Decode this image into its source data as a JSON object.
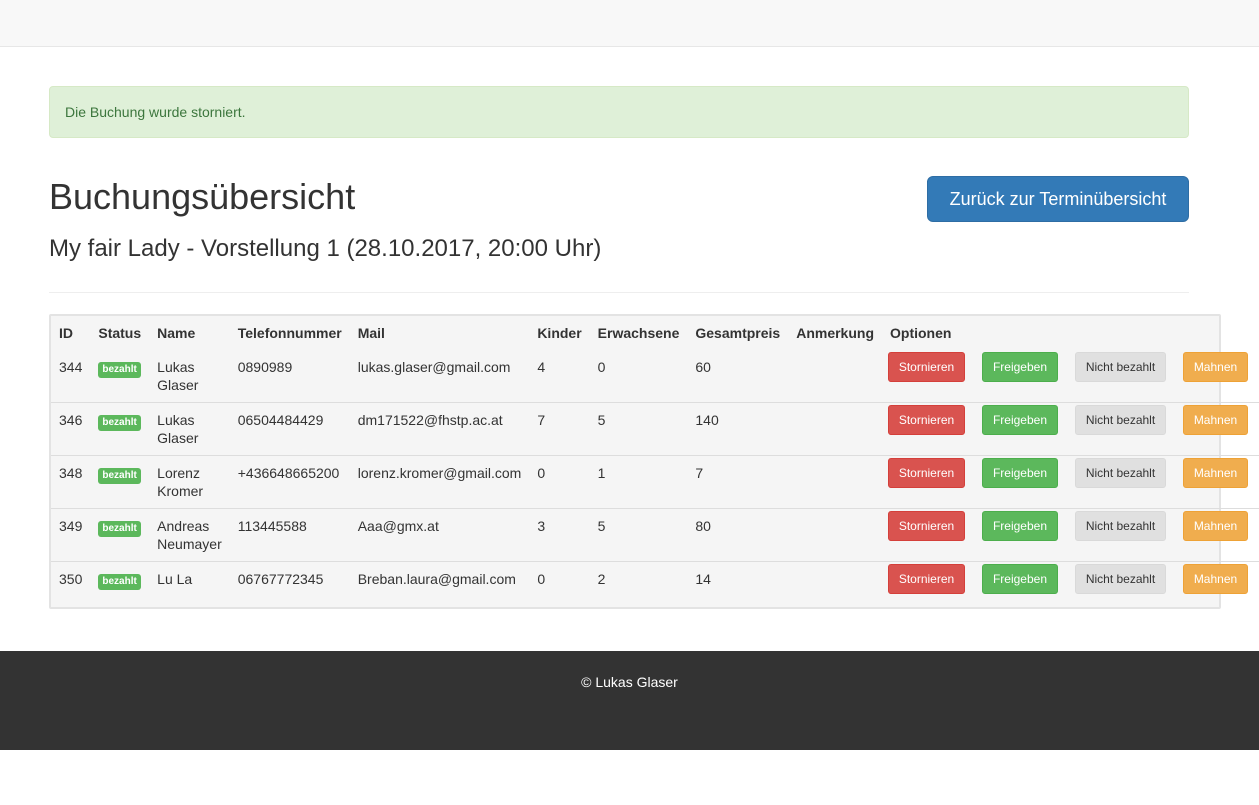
{
  "alert": {
    "text": "Die Buchung wurde storniert."
  },
  "header": {
    "title": "Buchungsübersicht",
    "back_button": "Zurück zur Terminübersicht",
    "subtitle": "My fair Lady - Vorstellung 1 (28.10.2017, 20:00 Uhr)"
  },
  "table": {
    "columns": [
      "ID",
      "Status",
      "Name",
      "Telefonnummer",
      "Mail",
      "Kinder",
      "Erwachsene",
      "Gesamtpreis",
      "Anmerkung",
      "Optionen"
    ],
    "actions": {
      "cancel": "Stornieren",
      "release": "Freigeben",
      "unpaid": "Nicht bezahlt",
      "remind": "Mahnen"
    },
    "rows": [
      {
        "id": "344",
        "status": "bezahlt",
        "name": "Lukas Glaser",
        "phone": "0890989",
        "mail": "lukas.glaser@gmail.com",
        "children": "4",
        "adults": "0",
        "total": "60",
        "note": ""
      },
      {
        "id": "346",
        "status": "bezahlt",
        "name": "Lukas Glaser",
        "phone": "06504484429",
        "mail": "dm171522@fhstp.ac.at",
        "children": "7",
        "adults": "5",
        "total": "140",
        "note": ""
      },
      {
        "id": "348",
        "status": "bezahlt",
        "name": "Lorenz Kromer",
        "phone": "+436648665200",
        "mail": "lorenz.kromer@gmail.com",
        "children": "0",
        "adults": "1",
        "total": "7",
        "note": ""
      },
      {
        "id": "349",
        "status": "bezahlt",
        "name": "Andreas Neumayer",
        "phone": "113445588",
        "mail": "Aaa@gmx.at",
        "children": "3",
        "adults": "5",
        "total": "80",
        "note": ""
      },
      {
        "id": "350",
        "status": "bezahlt",
        "name": "Lu La",
        "phone": "06767772345",
        "mail": "Breban.laura@gmail.com",
        "children": "0",
        "adults": "2",
        "total": "14",
        "note": ""
      }
    ]
  },
  "footer": {
    "text": "© Lukas Glaser"
  }
}
